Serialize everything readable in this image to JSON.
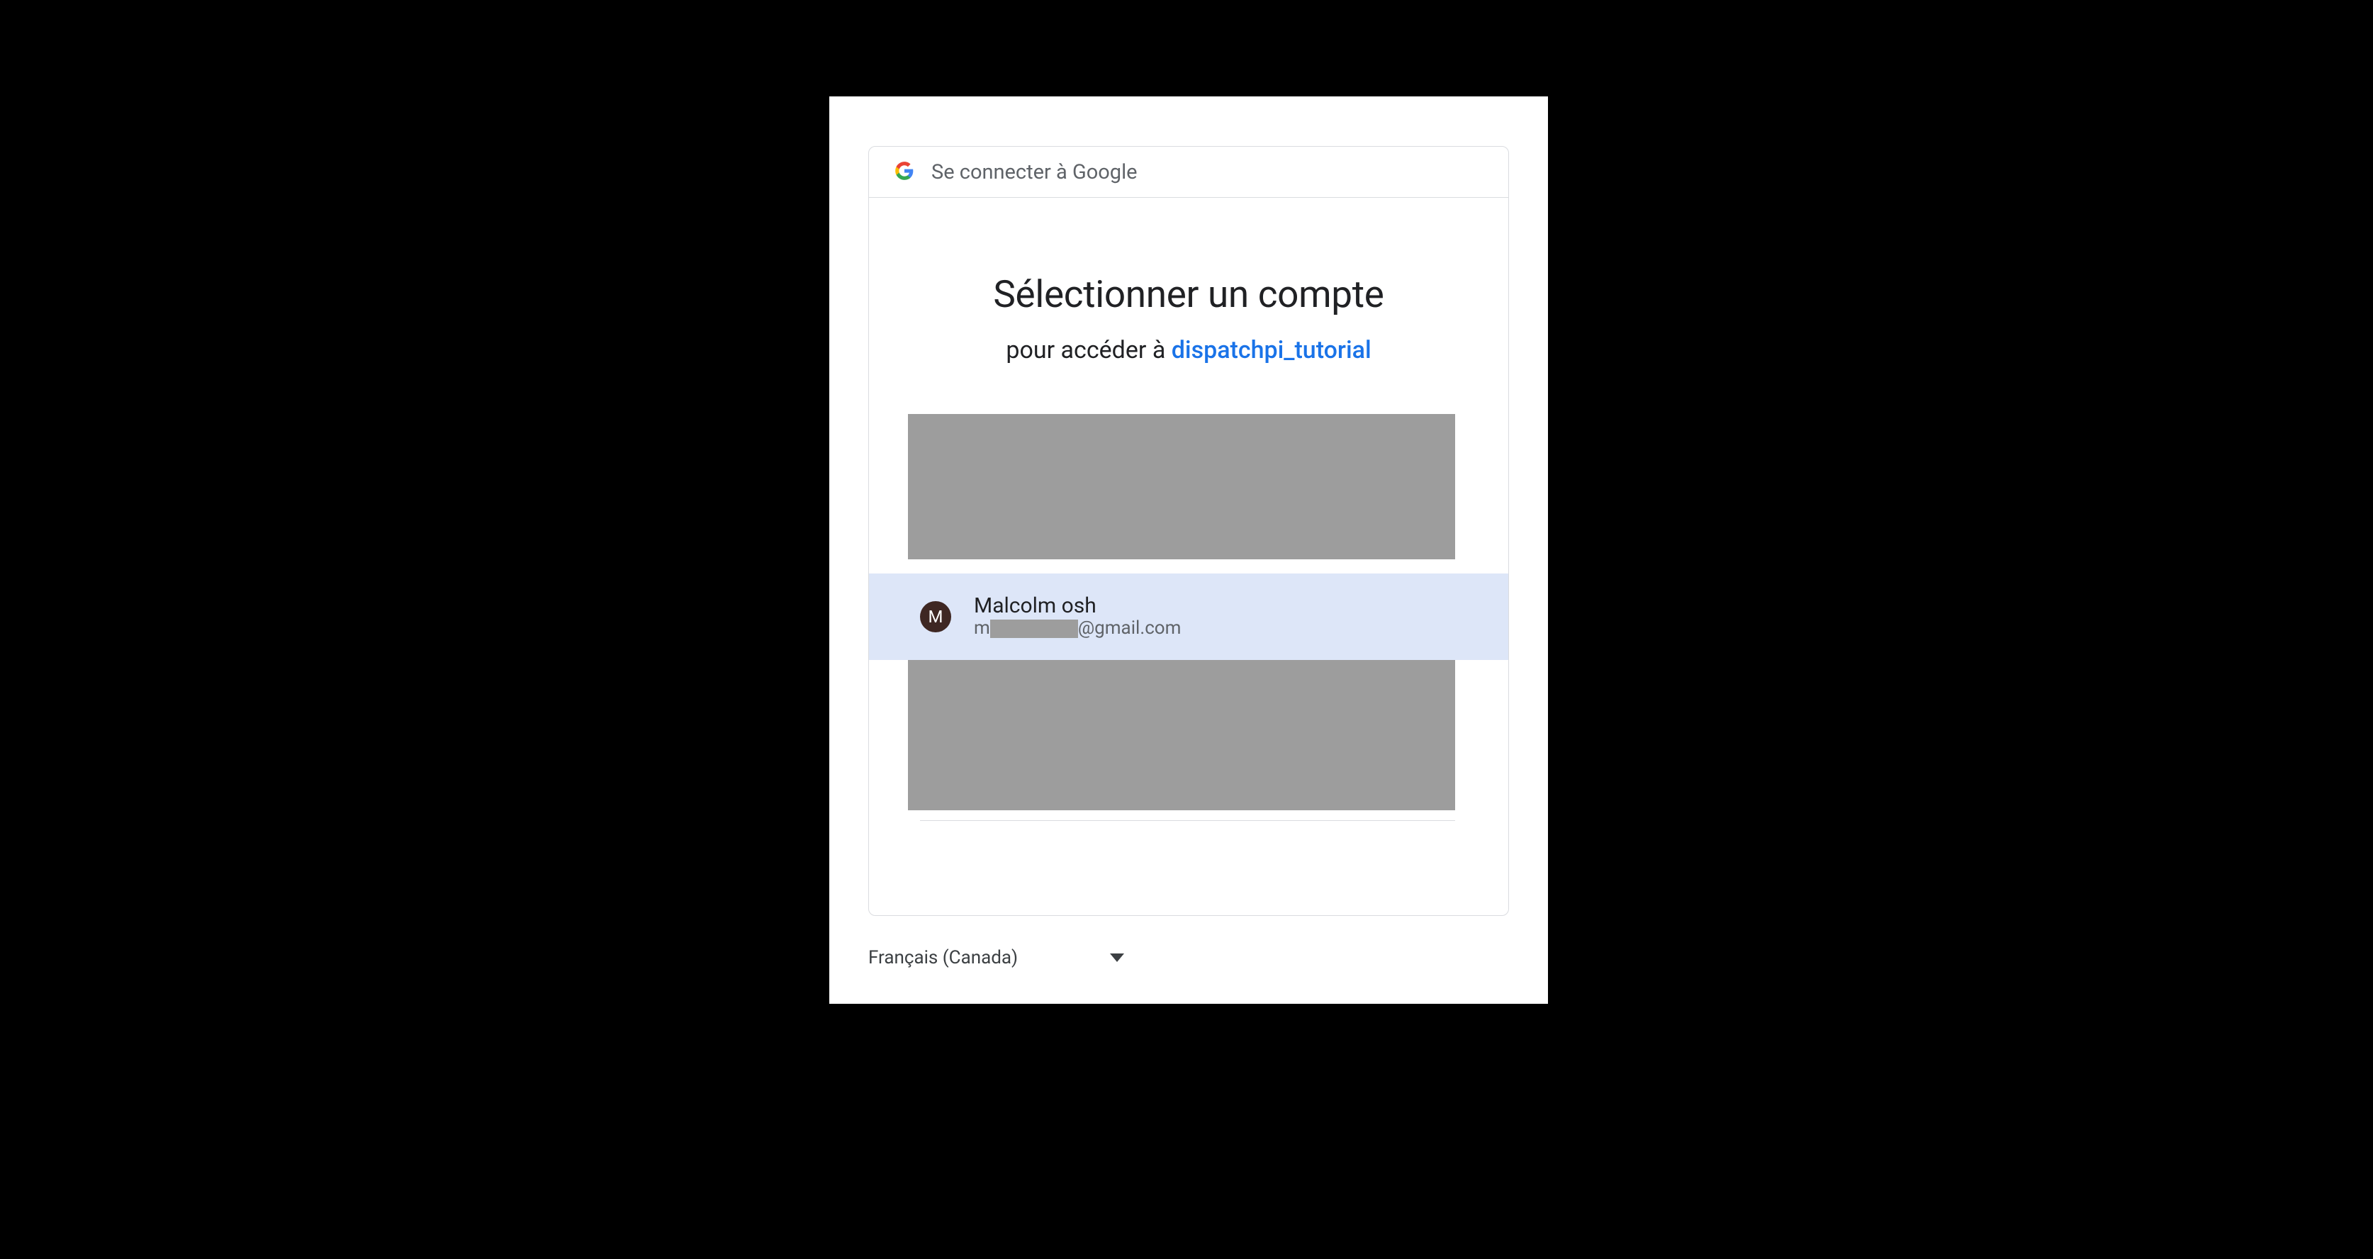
{
  "header": {
    "label": "Se connecter à Google"
  },
  "headings": {
    "title": "Sélectionner un compte",
    "subtitle_prefix": "pour accéder à ",
    "app_name": "dispatchpi_tutorial"
  },
  "account": {
    "avatar_initial": "M",
    "name": "Malcolm osh",
    "email_prefix": "m",
    "email_suffix": "@gmail.com"
  },
  "footer": {
    "language": "Français (Canada)"
  }
}
